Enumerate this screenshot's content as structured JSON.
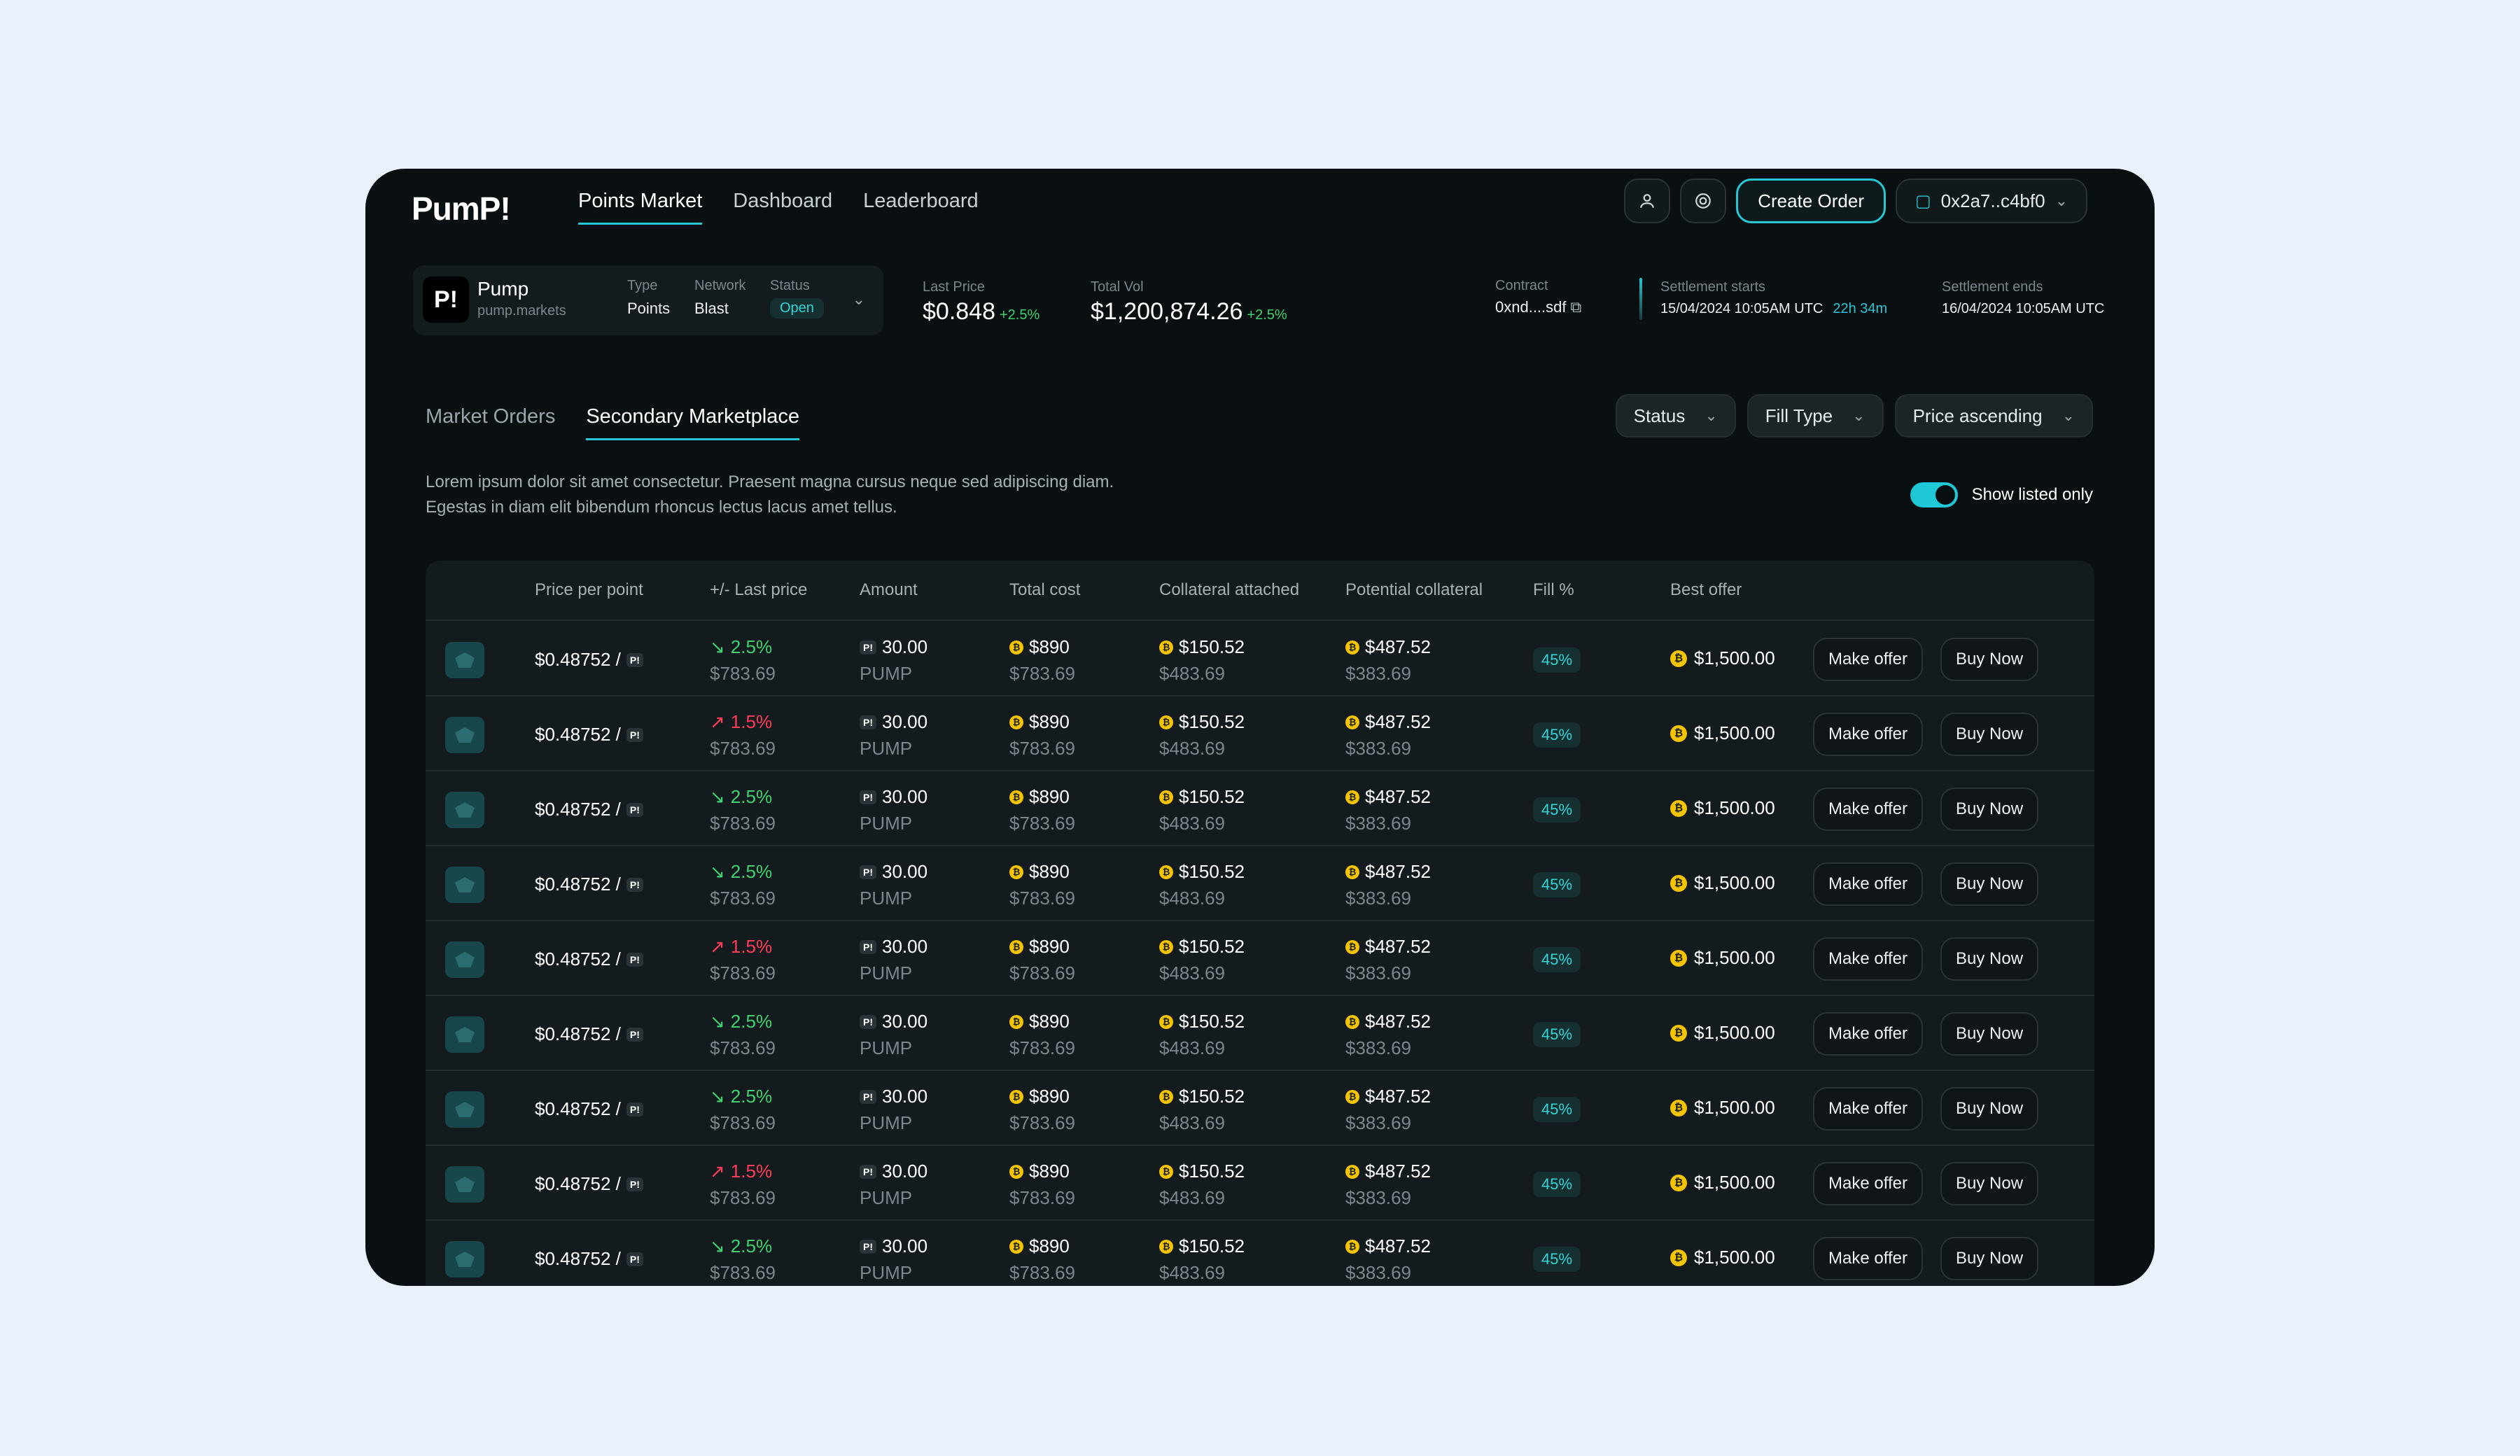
{
  "brand": {
    "logo": "PumP!"
  },
  "nav": {
    "items": [
      "Points Market",
      "Dashboard",
      "Leaderboard"
    ]
  },
  "header": {
    "create_order": "Create Order",
    "wallet": "0x2a7..c4bf0"
  },
  "project": {
    "logo_text": "P!",
    "name": "Pump",
    "url": "pump.markets",
    "type_label": "Type",
    "type_value": "Points",
    "network_label": "Network",
    "network_value": "Blast",
    "status_label": "Status",
    "status_value": "Open"
  },
  "stats": {
    "last_price_label": "Last Price",
    "last_price": "$0.848",
    "last_price_delta": "+2.5%",
    "total_vol_label": "Total Vol",
    "total_vol": "$1,200,874.26",
    "total_vol_delta": "+2.5%"
  },
  "contract": {
    "label": "Contract",
    "value": "0xnd....sdf"
  },
  "settlement": {
    "starts_label": "Settlement starts",
    "starts_value": "15/04/2024 10:05AM UTC",
    "countdown": "22h 34m",
    "ends_label": "Settlement ends",
    "ends_value": "16/04/2024 10:05AM UTC"
  },
  "tabs": [
    "Market Orders",
    "Secondary Marketplace"
  ],
  "filters": [
    "Status",
    "Fill Type",
    "Price ascending"
  ],
  "description": "Lorem ipsum dolor sit amet consectetur. Praesent magna cursus neque sed adipiscing diam. Egestas in diam elit bibendum rhoncus lectus lacus amet tellus.",
  "toggle_label": "Show listed only",
  "table": {
    "headers": [
      "Price per point",
      "+/- Last price",
      "Amount",
      "Total cost",
      "Collateral attached",
      "Potential collateral",
      "Fill %",
      "Best offer"
    ],
    "rows": [
      {
        "price": "$0.48752 /",
        "change": "2.5%",
        "dir": "up",
        "change_sub": "$783.69",
        "amount": "30.00",
        "amount_unit": "PUMP",
        "total": "$890",
        "total_sub": "$783.69",
        "coll": "$150.52",
        "coll_sub": "$483.69",
        "pot": "$487.52",
        "pot_sub": "$383.69",
        "fill": "45%",
        "best": "$1,500.00",
        "offer_btn": "Make offer",
        "buy_btn": "Buy Now"
      },
      {
        "price": "$0.48752 /",
        "change": "1.5%",
        "dir": "down",
        "change_sub": "$783.69",
        "amount": "30.00",
        "amount_unit": "PUMP",
        "total": "$890",
        "total_sub": "$783.69",
        "coll": "$150.52",
        "coll_sub": "$483.69",
        "pot": "$487.52",
        "pot_sub": "$383.69",
        "fill": "45%",
        "best": "$1,500.00",
        "offer_btn": "Make offer",
        "buy_btn": "Buy Now"
      },
      {
        "price": "$0.48752 /",
        "change": "2.5%",
        "dir": "up",
        "change_sub": "$783.69",
        "amount": "30.00",
        "amount_unit": "PUMP",
        "total": "$890",
        "total_sub": "$783.69",
        "coll": "$150.52",
        "coll_sub": "$483.69",
        "pot": "$487.52",
        "pot_sub": "$383.69",
        "fill": "45%",
        "best": "$1,500.00",
        "offer_btn": "Make offer",
        "buy_btn": "Buy Now"
      },
      {
        "price": "$0.48752 /",
        "change": "2.5%",
        "dir": "up",
        "change_sub": "$783.69",
        "amount": "30.00",
        "amount_unit": "PUMP",
        "total": "$890",
        "total_sub": "$783.69",
        "coll": "$150.52",
        "coll_sub": "$483.69",
        "pot": "$487.52",
        "pot_sub": "$383.69",
        "fill": "45%",
        "best": "$1,500.00",
        "offer_btn": "Make offer",
        "buy_btn": "Buy Now"
      },
      {
        "price": "$0.48752 /",
        "change": "1.5%",
        "dir": "down",
        "change_sub": "$783.69",
        "amount": "30.00",
        "amount_unit": "PUMP",
        "total": "$890",
        "total_sub": "$783.69",
        "coll": "$150.52",
        "coll_sub": "$483.69",
        "pot": "$487.52",
        "pot_sub": "$383.69",
        "fill": "45%",
        "best": "$1,500.00",
        "offer_btn": "Make offer",
        "buy_btn": "Buy Now"
      },
      {
        "price": "$0.48752 /",
        "change": "2.5%",
        "dir": "up",
        "change_sub": "$783.69",
        "amount": "30.00",
        "amount_unit": "PUMP",
        "total": "$890",
        "total_sub": "$783.69",
        "coll": "$150.52",
        "coll_sub": "$483.69",
        "pot": "$487.52",
        "pot_sub": "$383.69",
        "fill": "45%",
        "best": "$1,500.00",
        "offer_btn": "Make offer",
        "buy_btn": "Buy Now"
      },
      {
        "price": "$0.48752 /",
        "change": "2.5%",
        "dir": "up",
        "change_sub": "$783.69",
        "amount": "30.00",
        "amount_unit": "PUMP",
        "total": "$890",
        "total_sub": "$783.69",
        "coll": "$150.52",
        "coll_sub": "$483.69",
        "pot": "$487.52",
        "pot_sub": "$383.69",
        "fill": "45%",
        "best": "$1,500.00",
        "offer_btn": "Make offer",
        "buy_btn": "Buy Now"
      },
      {
        "price": "$0.48752 /",
        "change": "1.5%",
        "dir": "down",
        "change_sub": "$783.69",
        "amount": "30.00",
        "amount_unit": "PUMP",
        "total": "$890",
        "total_sub": "$783.69",
        "coll": "$150.52",
        "coll_sub": "$483.69",
        "pot": "$487.52",
        "pot_sub": "$383.69",
        "fill": "45%",
        "best": "$1,500.00",
        "offer_btn": "Make offer",
        "buy_btn": "Buy Now"
      },
      {
        "price": "$0.48752 /",
        "change": "2.5%",
        "dir": "up",
        "change_sub": "$783.69",
        "amount": "30.00",
        "amount_unit": "PUMP",
        "total": "$890",
        "total_sub": "$783.69",
        "coll": "$150.52",
        "coll_sub": "$483.69",
        "pot": "$487.52",
        "pot_sub": "$383.69",
        "fill": "45%",
        "best": "$1,500.00",
        "offer_btn": "Make offer",
        "buy_btn": "Buy Now"
      }
    ]
  },
  "colors": {
    "accent": "#27c7d4",
    "up": "#3fd26e",
    "down": "#ff3b58",
    "coin": "#f5c400"
  }
}
